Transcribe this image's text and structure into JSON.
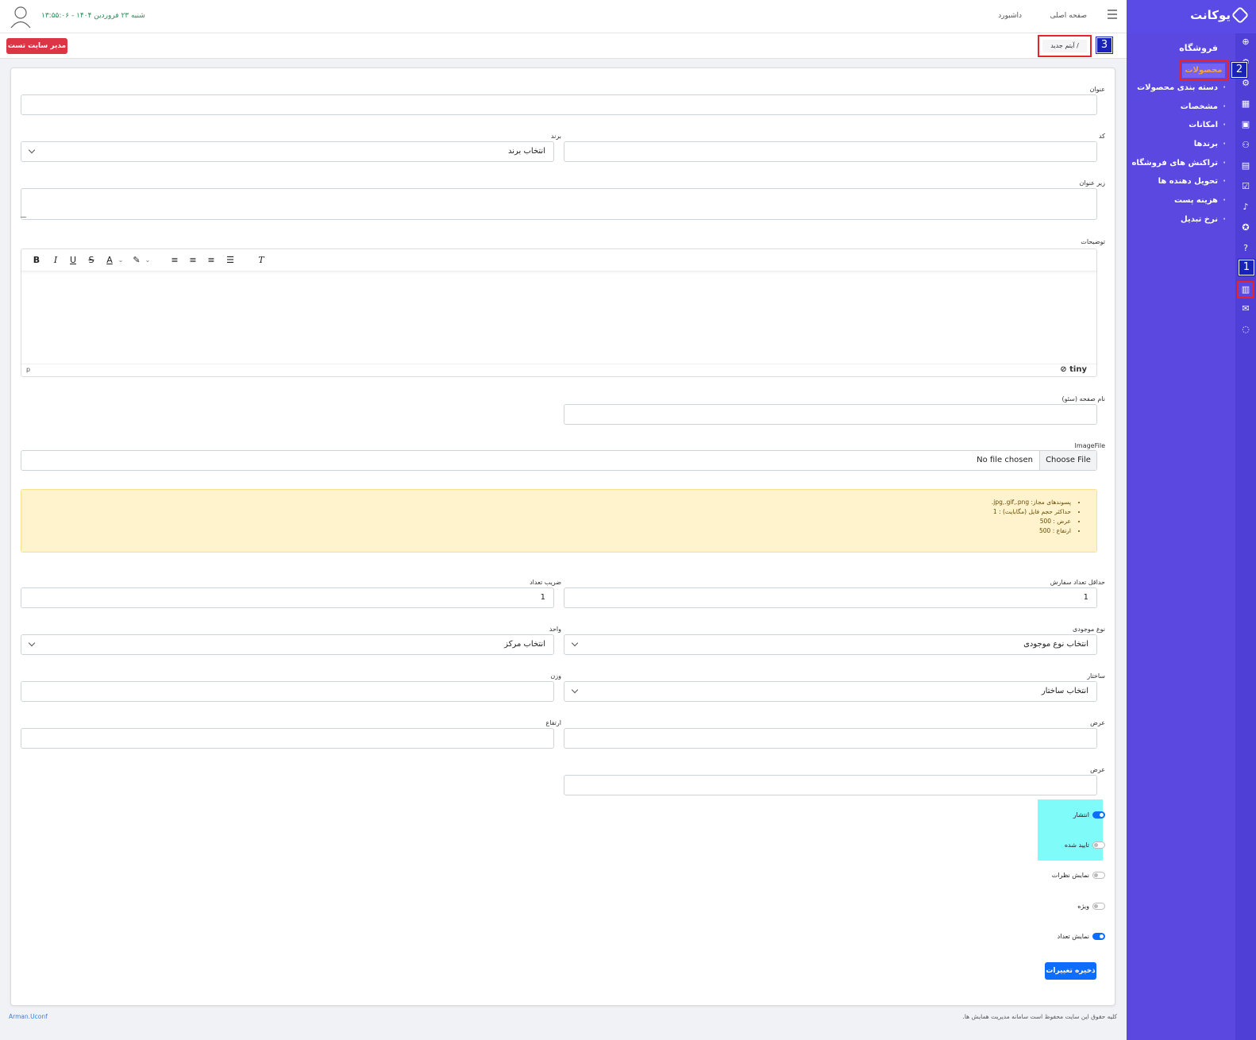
{
  "sidebar": {
    "logo": "یوکانت",
    "section_title": "فروشگاه",
    "items": [
      {
        "label": "محصولات",
        "active": true
      },
      {
        "label": "دسته بندی محصولات"
      },
      {
        "label": "مشخصات"
      },
      {
        "label": "امکانات"
      },
      {
        "label": "برندها"
      },
      {
        "label": "تراکنش های فروشگاه"
      },
      {
        "label": "تحویل دهنده ها"
      },
      {
        "label": "هزینه پست"
      },
      {
        "label": "نرخ تبدیل"
      }
    ],
    "rail_icons": [
      "globe-icon",
      "gear-icon",
      "settings-icon",
      "table-icon",
      "gallery-icon",
      "users-icon",
      "bookmark-icon",
      "check-icon",
      "mic-icon",
      "award-icon",
      "help-icon",
      "store-icon",
      "mail-icon",
      "chat-icon"
    ],
    "active_color": "#f2a342",
    "bg_color": "#5a48e0"
  },
  "topbar": {
    "home_link": "صفحه اصلی",
    "dashboard_link": "داشبورد",
    "datetime": "شنبه ۲۳ فروردین ۱۴۰۴ - ۱۳:۵۵:۰۶"
  },
  "breadcrumb": {
    "separator": "/",
    "current": "آیتم جدید"
  },
  "admin_button": "مدیر سایت تست",
  "steps": [
    "1",
    "2",
    "3"
  ],
  "form": {
    "title_label": "عنوان",
    "code_label": "کد",
    "brand_label": "برند",
    "brand_value": "انتخاب برند",
    "subtitle_label": "زیر عنوان",
    "description_label": "توضیحات",
    "editor_status_path": "p",
    "editor_brand": "tiny",
    "seo_label": "نام صفحه (سئو)",
    "image_label": "ImageFile",
    "file_button": "Choose File",
    "file_status": "No file chosen",
    "notes": [
      "پسوندهای مجاز: jpg,.gif,.png.",
      "حداکثر حجم فایل (مگابایت) : 1",
      "عرض : 500",
      "ارتفاع : 500"
    ],
    "min_order_label": "حداقل تعداد سفارش",
    "min_order_value": "1",
    "multiplier_label": "ضریب تعداد",
    "multiplier_value": "1",
    "stock_type_label": "نوع موجودی",
    "stock_type_value": "انتخاب نوع موجودی",
    "unit_label": "واحد",
    "unit_value": "انتخاب مرکز",
    "structure_label": "ساختار",
    "structure_value": "انتخاب ساختار",
    "weight_label": "وزن",
    "width_label": "عرض",
    "height_label": "ارتفاع",
    "width2_label": "عرض",
    "toggles": [
      {
        "label": "انتشار",
        "on": true
      },
      {
        "label": "تایید شده",
        "on": false
      },
      {
        "label": "نمایش نظرات",
        "on": false
      },
      {
        "label": "ویژه",
        "on": false
      },
      {
        "label": "نمایش تعداد",
        "on": true
      }
    ],
    "save_button": "ذخیره تغییرات"
  },
  "footer": {
    "copyright": "کلیه حقوق این سایت محفوظ است سامانه مدیریت همایش ها.",
    "credit": "Arman.Uconf"
  }
}
